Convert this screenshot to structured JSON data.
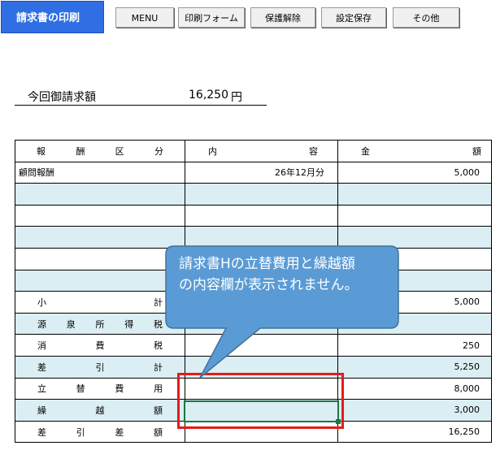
{
  "toolbar": {
    "print_label": "請求書の印刷",
    "menu_label": "MENU",
    "print_form_label": "印刷フォーム",
    "unprotect_label": "保護解除",
    "save_settings_label": "設定保存",
    "other_label": "その他"
  },
  "invoice_total": {
    "label": "今回御請求額",
    "amount": "16,250",
    "currency": "円"
  },
  "table": {
    "headers": {
      "category": "報酬区分",
      "content": "内容",
      "amount": "金額"
    },
    "rows": [
      {
        "category": "顧問報酬",
        "content": "26年12月分",
        "amount": "5,000"
      },
      {
        "category": "",
        "content": "",
        "amount": ""
      },
      {
        "category": "",
        "content": "",
        "amount": ""
      },
      {
        "category": "",
        "content": "",
        "amount": ""
      },
      {
        "category": "",
        "content": "",
        "amount": ""
      },
      {
        "category": "",
        "content": "",
        "amount": ""
      }
    ],
    "summary": [
      {
        "label": "小計",
        "content": "",
        "amount": "5,000"
      },
      {
        "label": "源泉所得税",
        "content": "",
        "amount": ""
      },
      {
        "label": "消費税",
        "content": "",
        "amount": "250"
      },
      {
        "label": "差引計",
        "content": "",
        "amount": "5,250"
      },
      {
        "label": "立替費用",
        "content": "",
        "amount": "8,000"
      },
      {
        "label": "繰越額",
        "content": "",
        "amount": "3,000"
      },
      {
        "label": "差引差額",
        "content": "",
        "amount": "16,250"
      }
    ]
  },
  "callout": {
    "line1": "請求書Hの立替費用と繰越額",
    "line2": "の内容欄が表示されません。",
    "fill_color": "#5b9bd5",
    "border_color": "#41719c"
  },
  "colors": {
    "print_button": "#2f6fe3",
    "alt_row": "#daeef3",
    "highlight_box": "#e21c1c",
    "selection": "#217346"
  }
}
